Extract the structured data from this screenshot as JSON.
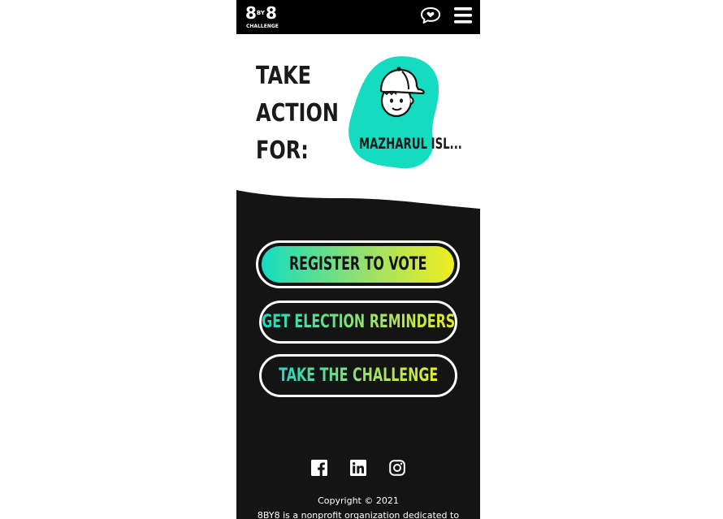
{
  "header": {
    "logo_main_left": "8",
    "logo_main_by": "BY",
    "logo_main_right": "8",
    "logo_sub": "CHALLENGE",
    "icons": [
      "chat-bubble-heart-icon",
      "hamburger-menu-icon"
    ]
  },
  "hero": {
    "line1": "TAKE",
    "line2": "ACTION",
    "line3": "FOR:",
    "name": "MAZHARUL ISL...",
    "avatar_icon": "cap-boy-avatar-icon"
  },
  "actions": {
    "register": "REGISTER TO VOTE",
    "reminders": "GET ELECTION REMINDERS",
    "challenge": "TAKE THE CHALLENGE"
  },
  "footer": {
    "social_icons": [
      "facebook-icon",
      "linkedin-icon",
      "instagram-icon"
    ],
    "copyright": "Copyright © 2021",
    "about": "8BY8 is a nonprofit organization dedicated to"
  },
  "colors": {
    "teal": "#14dcc1",
    "yellow": "#f0ee1e",
    "dark": "#141414",
    "header_bg": "#000000"
  }
}
